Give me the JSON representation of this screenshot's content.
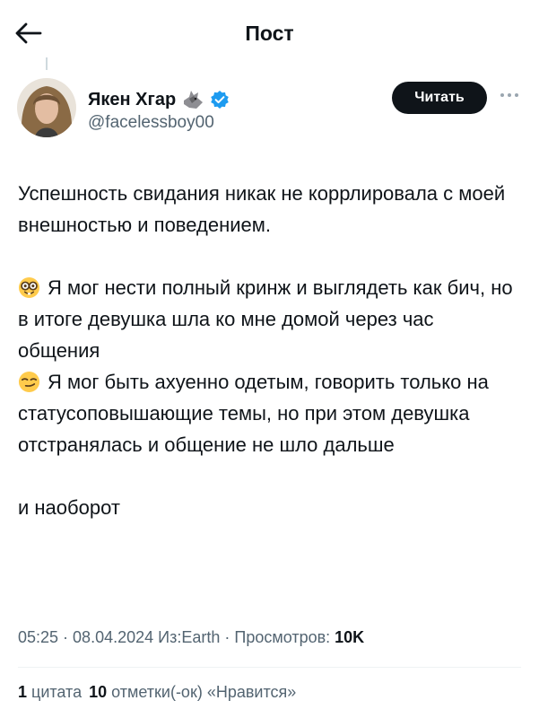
{
  "header": {
    "title": "Пост"
  },
  "author": {
    "name": "Якен Хгар",
    "handle": "@facelessboy00",
    "follow_label": "Читать"
  },
  "post": {
    "para1": "Успешность свидания никак не коррлировала с моей внешностью и поведением.",
    "item1": "Я мог нести полный кринж и выглядеть как бич, но в итоге девушка шла ко мне домой через час общения",
    "item2": "Я мог быть ахуенно одетым, говорить только на статусоповышающие темы, но при этом девушка отстранялась и общение не шло дальше",
    "para2": "и наоборот"
  },
  "meta": {
    "time": "05:25",
    "sep1": " · ",
    "date": "08.04.2024",
    "sep2": " ",
    "source": "Из:Earth",
    "sep3": " · ",
    "views_label": "Просмотров: ",
    "views_value": "10K"
  },
  "stats": {
    "quotes_count": "1",
    "quotes_label": " цитата",
    "likes_count": "10",
    "likes_label": " отметки(-ок) «Нравится»"
  },
  "colors": {
    "text": "#0f1419",
    "secondary": "#536471",
    "verified": "#1d9bf0",
    "button": "#0f1419"
  },
  "icons": [
    "back-arrow-icon",
    "wolf-emoji-icon",
    "verified-badge-icon",
    "more-icon",
    "nerd-face-emoji-icon",
    "smirk-face-emoji-icon"
  ]
}
